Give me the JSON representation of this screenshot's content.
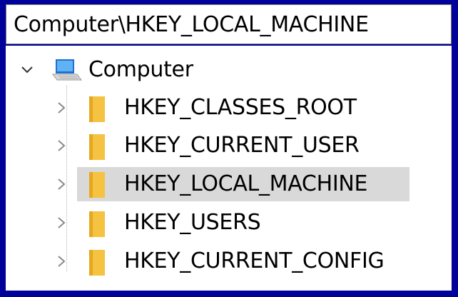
{
  "address_bar": {
    "path": "Computer\\HKEY_LOCAL_MACHINE"
  },
  "tree": {
    "root": {
      "label": "Computer",
      "expanded": true,
      "icon": "computer-icon"
    },
    "children": [
      {
        "label": "HKEY_CLASSES_ROOT",
        "selected": false,
        "icon": "folder-icon"
      },
      {
        "label": "HKEY_CURRENT_USER",
        "selected": false,
        "icon": "folder-icon"
      },
      {
        "label": "HKEY_LOCAL_MACHINE",
        "selected": true,
        "icon": "folder-icon"
      },
      {
        "label": "HKEY_USERS",
        "selected": false,
        "icon": "folder-icon"
      },
      {
        "label": "HKEY_CURRENT_CONFIG",
        "selected": false,
        "icon": "folder-icon"
      }
    ]
  },
  "colors": {
    "frame": "#00009a",
    "selection": "#d9d9d9",
    "folder": "#f5c242"
  }
}
